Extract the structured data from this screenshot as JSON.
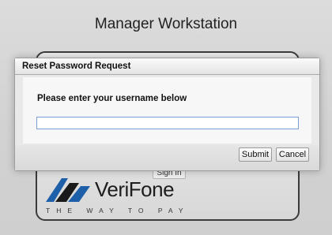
{
  "window": {
    "title": "Manager Workstation"
  },
  "login": {
    "signin_label": "Sign In",
    "brand_name": "VeriFone",
    "brand_tagline": "THE WAY TO PAY",
    "brand_colors": {
      "mark_blue": "#1d5fa8",
      "mark_dark": "#1a1a1a"
    }
  },
  "dialog": {
    "title": "Reset Password Request",
    "prompt": "Please enter your username below",
    "username": {
      "value": "",
      "placeholder": ""
    },
    "submit_label": "Submit",
    "cancel_label": "Cancel"
  }
}
